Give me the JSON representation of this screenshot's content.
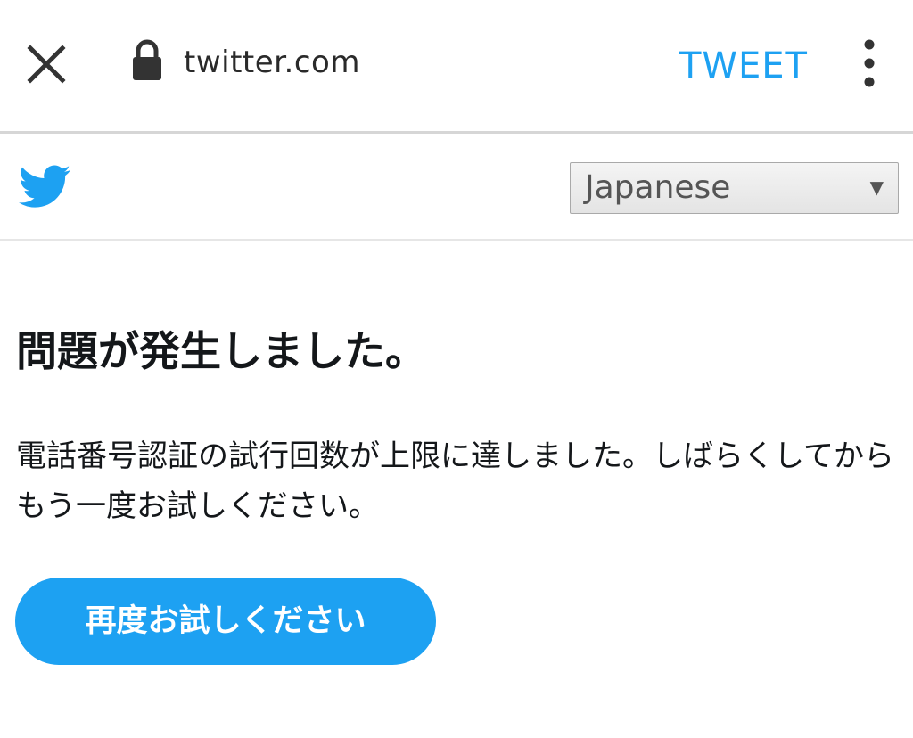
{
  "browser": {
    "url": "twitter.com",
    "tweet_label": "TWEET",
    "icons": {
      "close": "close-icon",
      "lock": "lock-icon",
      "more": "more-vertical-icon"
    }
  },
  "header": {
    "logo": "twitter-bird-icon",
    "language_select": {
      "selected": "Japanese"
    }
  },
  "main": {
    "title": "問題が発生しました。",
    "message": "電話番号認証の試行回数が上限に達しました。しばらくしてからもう一度お試しください。",
    "retry_button_label": "再度お試しください"
  },
  "colors": {
    "accent": "#1da1f2",
    "text": "#14171a"
  }
}
